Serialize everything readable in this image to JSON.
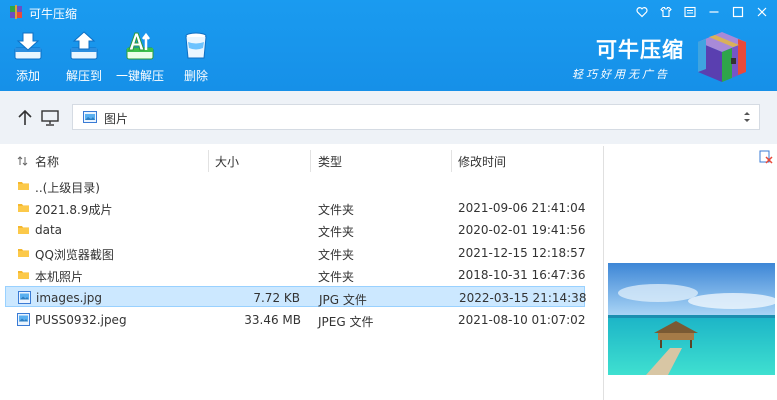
{
  "app": {
    "title": "可牛压缩"
  },
  "toolbar": {
    "add_label": "添加",
    "extract_to_label": "解压到",
    "oneclick_label": "一键解压",
    "delete_label": "删除"
  },
  "brand": {
    "name": "可牛压缩",
    "slogan": "轻巧好用无广告"
  },
  "address": {
    "path": "图片"
  },
  "columns": {
    "name": "名称",
    "size": "大小",
    "type": "类型",
    "modified": "修改时间"
  },
  "files": [
    {
      "name": "..(上级目录)",
      "size": "",
      "type": "",
      "modified": "",
      "icon": "folder-icon"
    },
    {
      "name": "2021.8.9成片",
      "size": "",
      "type": "文件夹",
      "modified": "2021-09-06 21:41:04",
      "icon": "folder-icon"
    },
    {
      "name": "data",
      "size": "",
      "type": "文件夹",
      "modified": "2020-02-01 19:41:56",
      "icon": "folder-icon"
    },
    {
      "name": "QQ浏览器截图",
      "size": "",
      "type": "文件夹",
      "modified": "2021-12-15 12:18:57",
      "icon": "folder-icon"
    },
    {
      "name": "本机照片",
      "size": "",
      "type": "文件夹",
      "modified": "2018-10-31 16:47:36",
      "icon": "folder-icon"
    },
    {
      "name": "images.jpg",
      "size": "7.72 KB",
      "type": "JPG 文件",
      "modified": "2022-03-15 21:14:38",
      "icon": "image-file-icon",
      "selected": true
    },
    {
      "name": "PUSS0932.jpeg",
      "size": "33.46 MB",
      "type": "JPEG 文件",
      "modified": "2021-08-10 01:07:02",
      "icon": "image-file-icon"
    }
  ],
  "colors": {
    "header_blue": "#1a9bf0",
    "selection": "#cce8ff",
    "folder": "#f5b82e"
  }
}
